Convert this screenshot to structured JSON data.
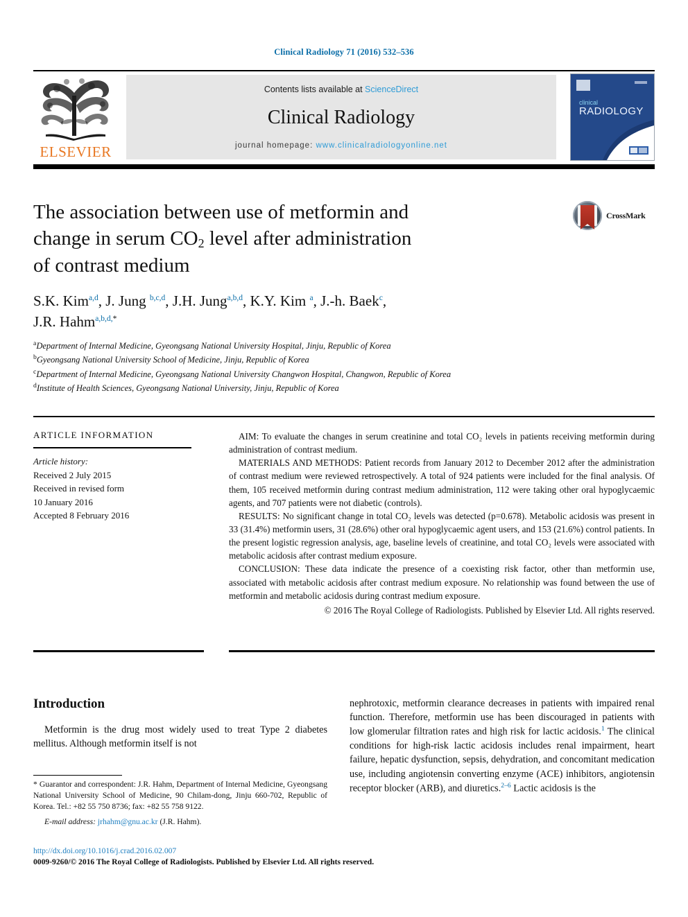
{
  "running_head": "Clinical Radiology 71 (2016) 532–536",
  "masthead": {
    "publisher_name": "ELSEVIER",
    "contents_prefix": "Contents lists available at ",
    "contents_link": "ScienceDirect",
    "journal_name": "Clinical Radiology",
    "homepage_label": "journal homepage: ",
    "homepage_url": "www.clinicalradiologyonline.net",
    "cover_title_small": "clinical",
    "cover_title_large": "RADIOLOGY"
  },
  "article": {
    "title_line1": "The association between use of metformin and",
    "title_line2_a": "change in serum CO",
    "title_line2_sub": "2",
    "title_line2_b": " level after administration",
    "title_line3": "of contrast medium",
    "crossmark_label": "CrossMark",
    "authors": [
      {
        "name": "S.K. Kim",
        "sup": "a,d",
        "sep": ", "
      },
      {
        "name": "J. Jung ",
        "sup": "b,c,d",
        "sep": ", "
      },
      {
        "name": "J.H. Jung",
        "sup": "a,b,d",
        "sep": ", "
      },
      {
        "name": "K.Y. Kim ",
        "sup": "a",
        "sep": ", "
      },
      {
        "name": "J.-h. Baek",
        "sup": "c",
        "sep": ", "
      },
      {
        "name": "J.R. Hahm",
        "sup": "a,b,d,",
        "star": "*",
        "sep": ""
      }
    ],
    "affiliations": [
      {
        "mark": "a",
        "text": "Department of Internal Medicine, Gyeongsang National University Hospital, Jinju, Republic of Korea"
      },
      {
        "mark": "b",
        "text": "Gyeongsang National University School of Medicine, Jinju, Republic of Korea"
      },
      {
        "mark": "c",
        "text": "Department of Internal Medicine, Gyeongsang National University Changwon Hospital, Changwon, Republic of Korea"
      },
      {
        "mark": "d",
        "text": "Institute of Health Sciences, Gyeongsang National University, Jinju, Republic of Korea"
      }
    ]
  },
  "article_information": {
    "heading": "ARTICLE INFORMATION",
    "history_label": "Article history:",
    "history": [
      "Received 2 July 2015",
      "Received in revised form",
      "10 January 2016",
      "Accepted 8 February 2016"
    ]
  },
  "abstract": {
    "aim_label": "AIM:",
    "aim_text": " To evaluate the changes in serum creatinine and total CO₂ levels in patients receiving metformin during administration of contrast medium.",
    "methods_label": "MATERIALS AND METHODS:",
    "methods_text": " Patient records from January 2012 to December 2012 after the administration of contrast medium were reviewed retrospectively. A total of 924 patients were included for the final analysis. Of them, 105 received metformin during contrast medium administration, 112 were taking other oral hypoglycaemic agents, and 707 patients were not diabetic (controls).",
    "results_label": "RESULTS:",
    "results_text": " No significant change in total CO₂ levels was detected (p=0.678). Metabolic acidosis was present in 33 (31.4%) metformin users, 31 (28.6%) other oral hypoglycaemic agent users, and 153 (21.6%) control patients. In the present logistic regression analysis, age, baseline levels of creatinine, and total CO₂ levels were associated with metabolic acidosis after contrast medium exposure.",
    "conclusion_label": "CONCLUSION:",
    "conclusion_text": " These data indicate the presence of a coexisting risk factor, other than metformin use, associated with metabolic acidosis after contrast medium exposure. No relationship was found between the use of metformin and metabolic acidosis during contrast medium exposure.",
    "copyright": "© 2016 The Royal College of Radiologists. Published by Elsevier Ltd. All rights reserved."
  },
  "body": {
    "section_heading": "Introduction",
    "left_paragraph": "Metformin is the drug most widely used to treat Type 2 diabetes mellitus. Although metformin itself is not",
    "right_paragraph_a": "nephrotoxic, metformin clearance decreases in patients with impaired renal function. Therefore, metformin use has been discouraged in patients with low glomerular filtration rates and high risk for lactic acidosis.",
    "right_ref_1": "1",
    "right_paragraph_b": " The clinical conditions for high-risk lactic acidosis includes renal impairment, heart failure, hepatic dysfunction, sepsis, dehydration, and concomitant medication use, including angiotensin converting enzyme (ACE) inhibitors, angiotensin receptor blocker (ARB), and diuretics.",
    "right_ref_2": "2–6",
    "right_paragraph_c": " Lactic acidosis is the"
  },
  "footnote": {
    "text": "* Guarantor and correspondent: J.R. Hahm, Department of Internal Medicine, Gyeongsang National University School of Medicine, 90 Chilam-dong, Jinju 660-702, Republic of Korea. Tel.: +82 55 750 8736; fax: +82 55 758 9122.",
    "email_label": "E-mail address:",
    "email": "jrhahm@gnu.ac.kr",
    "email_owner": "(J.R. Hahm)."
  },
  "footer": {
    "doi": "http://dx.doi.org/10.1016/j.crad.2016.02.007",
    "issn_line": "0009-9260/© 2016 The Royal College of Radiologists. Published by Elsevier Ltd. All rights reserved."
  },
  "colors": {
    "link_blue": "#2e9bd6",
    "header_blue": "#0b6ea8",
    "elsevier_orange": "#E87722",
    "cover_navy": "#1b3a72"
  }
}
